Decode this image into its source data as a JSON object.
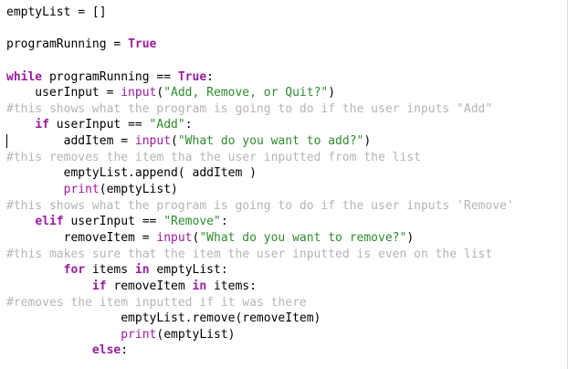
{
  "lines": [
    [
      {
        "t": "emptyList = []",
        "c": "plain"
      }
    ],
    [],
    [
      {
        "t": "programRunning = ",
        "c": "plain"
      },
      {
        "t": "True",
        "c": "kw"
      }
    ],
    [],
    [
      {
        "t": "while",
        "c": "kw"
      },
      {
        "t": " programRunning == ",
        "c": "plain"
      },
      {
        "t": "True",
        "c": "kw"
      },
      {
        "t": ":",
        "c": "plain"
      }
    ],
    [
      {
        "t": "    userInput = ",
        "c": "plain"
      },
      {
        "t": "input",
        "c": "fn"
      },
      {
        "t": "(",
        "c": "plain"
      },
      {
        "t": "\"Add, Remove, or Quit?\"",
        "c": "str"
      },
      {
        "t": ")",
        "c": "plain"
      }
    ],
    [
      {
        "t": "#this shows what the program is going to do if the user inputs \"Add\"",
        "c": "cm"
      }
    ],
    [
      {
        "t": "    ",
        "c": "plain"
      },
      {
        "t": "if",
        "c": "kw"
      },
      {
        "t": " userInput == ",
        "c": "plain"
      },
      {
        "t": "\"Add\"",
        "c": "str"
      },
      {
        "t": ":",
        "c": "plain"
      }
    ],
    [
      {
        "t": "        addItem = ",
        "c": "plain"
      },
      {
        "t": "input",
        "c": "fn"
      },
      {
        "t": "(",
        "c": "plain"
      },
      {
        "t": "\"What do you want to add?\"",
        "c": "str"
      },
      {
        "t": ")",
        "c": "plain"
      }
    ],
    [
      {
        "t": "#this removes the item tha the user inputted from the list",
        "c": "cm"
      }
    ],
    [
      {
        "t": "        emptyList.append( addItem )",
        "c": "plain"
      }
    ],
    [
      {
        "t": "        ",
        "c": "plain"
      },
      {
        "t": "print",
        "c": "fn"
      },
      {
        "t": "(emptyList)",
        "c": "plain"
      }
    ],
    [
      {
        "t": "#this shows what the program is going to do if the user inputs 'Remove'",
        "c": "cm"
      }
    ],
    [
      {
        "t": "    ",
        "c": "plain"
      },
      {
        "t": "elif",
        "c": "kw"
      },
      {
        "t": " userInput == ",
        "c": "plain"
      },
      {
        "t": "\"Remove\"",
        "c": "str"
      },
      {
        "t": ":",
        "c": "plain"
      }
    ],
    [
      {
        "t": "        removeItem = ",
        "c": "plain"
      },
      {
        "t": "input",
        "c": "fn"
      },
      {
        "t": "(",
        "c": "plain"
      },
      {
        "t": "\"What do you want to remove?\"",
        "c": "str"
      },
      {
        "t": ")",
        "c": "plain"
      }
    ],
    [
      {
        "t": "#this makes sure that the item the user inputted is even on the list",
        "c": "cm"
      }
    ],
    [
      {
        "t": "        ",
        "c": "plain"
      },
      {
        "t": "for",
        "c": "kw"
      },
      {
        "t": " items ",
        "c": "plain"
      },
      {
        "t": "in",
        "c": "kw"
      },
      {
        "t": " emptyList:",
        "c": "plain"
      }
    ],
    [
      {
        "t": "            ",
        "c": "plain"
      },
      {
        "t": "if",
        "c": "kw"
      },
      {
        "t": " removeItem ",
        "c": "plain"
      },
      {
        "t": "in",
        "c": "kw"
      },
      {
        "t": " items:",
        "c": "plain"
      }
    ],
    [
      {
        "t": "#removes the item inputted if it was there",
        "c": "cm"
      }
    ],
    [
      {
        "t": "                emptyList.remove(removeItem)",
        "c": "plain"
      }
    ],
    [
      {
        "t": "                ",
        "c": "plain"
      },
      {
        "t": "print",
        "c": "fn"
      },
      {
        "t": "(emptyList)",
        "c": "plain"
      }
    ],
    [
      {
        "t": "            ",
        "c": "plain"
      },
      {
        "t": "else",
        "c": "kw"
      },
      {
        "t": ":",
        "c": "plain"
      }
    ]
  ],
  "cursor_line": 8,
  "colors": {
    "keyword": "#9b1ba0",
    "string": "#2e8b2e",
    "comment": "#b5b5b5",
    "text": "#000000",
    "background": "#ffffff"
  }
}
